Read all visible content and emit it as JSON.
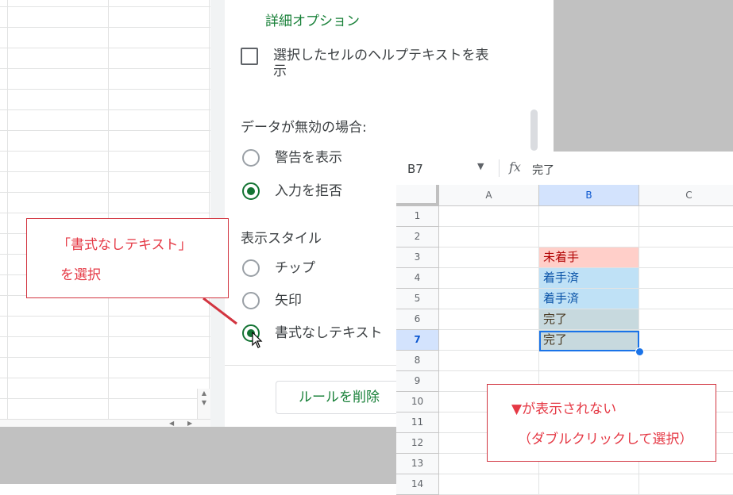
{
  "panel": {
    "advanced_options": "詳細オプション",
    "help_text_checkbox_line1": "選択したセルのヘルプテキストを表",
    "help_text_checkbox_line2": "示",
    "invalid_data_label": "データが無効の場合:",
    "invalid_options": [
      {
        "label": "警告を表示",
        "selected": false
      },
      {
        "label": "入力を拒否",
        "selected": true
      }
    ],
    "display_style_label": "表示スタイル",
    "display_style_options": [
      {
        "label": "チップ",
        "selected": false
      },
      {
        "label": "矢印",
        "selected": false
      },
      {
        "label": "書式なしテキスト",
        "selected": true
      }
    ],
    "delete_rule_button": "ルールを削除"
  },
  "callouts": {
    "left_line1": "「書式なしテキスト」",
    "left_line2": "を選択",
    "right_line1": "▼が表示されない",
    "right_line2": "（ダブルクリックして選択）"
  },
  "sheet": {
    "name_box": "B7",
    "fx_label": "fx",
    "formula_value": "完了",
    "columns": [
      "A",
      "B",
      "C"
    ],
    "rows": [
      "1",
      "2",
      "3",
      "4",
      "5",
      "6",
      "7",
      "8",
      "9",
      "10",
      "11",
      "12",
      "13",
      "14"
    ],
    "selected_column": "B",
    "selected_row": "7",
    "cells": [
      {
        "row": 3,
        "col": "B",
        "value": "未着手",
        "style": "red"
      },
      {
        "row": 4,
        "col": "B",
        "value": "着手済",
        "style": "blue"
      },
      {
        "row": 5,
        "col": "B",
        "value": "着手済",
        "style": "blue"
      },
      {
        "row": 6,
        "col": "B",
        "value": "完了",
        "style": "gray"
      },
      {
        "row": 7,
        "col": "B",
        "value": "完了",
        "style": "gray"
      }
    ]
  },
  "colors": {
    "accent_green": "#188038",
    "radio_green": "#137333",
    "callout_red": "#e53945",
    "selection_blue": "#1a73e8"
  }
}
